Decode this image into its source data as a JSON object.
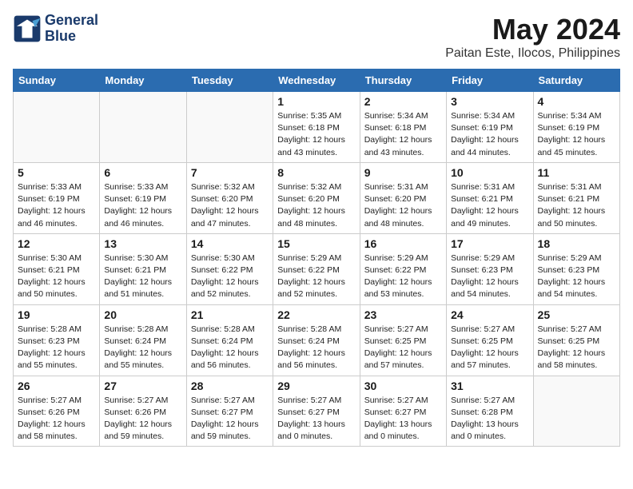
{
  "logo": {
    "line1": "General",
    "line2": "Blue"
  },
  "title": "May 2024",
  "location": "Paitan Este, Ilocos, Philippines",
  "weekdays": [
    "Sunday",
    "Monday",
    "Tuesday",
    "Wednesday",
    "Thursday",
    "Friday",
    "Saturday"
  ],
  "weeks": [
    [
      {
        "day": "",
        "info": ""
      },
      {
        "day": "",
        "info": ""
      },
      {
        "day": "",
        "info": ""
      },
      {
        "day": "1",
        "info": "Sunrise: 5:35 AM\nSunset: 6:18 PM\nDaylight: 12 hours\nand 43 minutes."
      },
      {
        "day": "2",
        "info": "Sunrise: 5:34 AM\nSunset: 6:18 PM\nDaylight: 12 hours\nand 43 minutes."
      },
      {
        "day": "3",
        "info": "Sunrise: 5:34 AM\nSunset: 6:19 PM\nDaylight: 12 hours\nand 44 minutes."
      },
      {
        "day": "4",
        "info": "Sunrise: 5:34 AM\nSunset: 6:19 PM\nDaylight: 12 hours\nand 45 minutes."
      }
    ],
    [
      {
        "day": "5",
        "info": "Sunrise: 5:33 AM\nSunset: 6:19 PM\nDaylight: 12 hours\nand 46 minutes."
      },
      {
        "day": "6",
        "info": "Sunrise: 5:33 AM\nSunset: 6:19 PM\nDaylight: 12 hours\nand 46 minutes."
      },
      {
        "day": "7",
        "info": "Sunrise: 5:32 AM\nSunset: 6:20 PM\nDaylight: 12 hours\nand 47 minutes."
      },
      {
        "day": "8",
        "info": "Sunrise: 5:32 AM\nSunset: 6:20 PM\nDaylight: 12 hours\nand 48 minutes."
      },
      {
        "day": "9",
        "info": "Sunrise: 5:31 AM\nSunset: 6:20 PM\nDaylight: 12 hours\nand 48 minutes."
      },
      {
        "day": "10",
        "info": "Sunrise: 5:31 AM\nSunset: 6:21 PM\nDaylight: 12 hours\nand 49 minutes."
      },
      {
        "day": "11",
        "info": "Sunrise: 5:31 AM\nSunset: 6:21 PM\nDaylight: 12 hours\nand 50 minutes."
      }
    ],
    [
      {
        "day": "12",
        "info": "Sunrise: 5:30 AM\nSunset: 6:21 PM\nDaylight: 12 hours\nand 50 minutes."
      },
      {
        "day": "13",
        "info": "Sunrise: 5:30 AM\nSunset: 6:21 PM\nDaylight: 12 hours\nand 51 minutes."
      },
      {
        "day": "14",
        "info": "Sunrise: 5:30 AM\nSunset: 6:22 PM\nDaylight: 12 hours\nand 52 minutes."
      },
      {
        "day": "15",
        "info": "Sunrise: 5:29 AM\nSunset: 6:22 PM\nDaylight: 12 hours\nand 52 minutes."
      },
      {
        "day": "16",
        "info": "Sunrise: 5:29 AM\nSunset: 6:22 PM\nDaylight: 12 hours\nand 53 minutes."
      },
      {
        "day": "17",
        "info": "Sunrise: 5:29 AM\nSunset: 6:23 PM\nDaylight: 12 hours\nand 54 minutes."
      },
      {
        "day": "18",
        "info": "Sunrise: 5:29 AM\nSunset: 6:23 PM\nDaylight: 12 hours\nand 54 minutes."
      }
    ],
    [
      {
        "day": "19",
        "info": "Sunrise: 5:28 AM\nSunset: 6:23 PM\nDaylight: 12 hours\nand 55 minutes."
      },
      {
        "day": "20",
        "info": "Sunrise: 5:28 AM\nSunset: 6:24 PM\nDaylight: 12 hours\nand 55 minutes."
      },
      {
        "day": "21",
        "info": "Sunrise: 5:28 AM\nSunset: 6:24 PM\nDaylight: 12 hours\nand 56 minutes."
      },
      {
        "day": "22",
        "info": "Sunrise: 5:28 AM\nSunset: 6:24 PM\nDaylight: 12 hours\nand 56 minutes."
      },
      {
        "day": "23",
        "info": "Sunrise: 5:27 AM\nSunset: 6:25 PM\nDaylight: 12 hours\nand 57 minutes."
      },
      {
        "day": "24",
        "info": "Sunrise: 5:27 AM\nSunset: 6:25 PM\nDaylight: 12 hours\nand 57 minutes."
      },
      {
        "day": "25",
        "info": "Sunrise: 5:27 AM\nSunset: 6:25 PM\nDaylight: 12 hours\nand 58 minutes."
      }
    ],
    [
      {
        "day": "26",
        "info": "Sunrise: 5:27 AM\nSunset: 6:26 PM\nDaylight: 12 hours\nand 58 minutes."
      },
      {
        "day": "27",
        "info": "Sunrise: 5:27 AM\nSunset: 6:26 PM\nDaylight: 12 hours\nand 59 minutes."
      },
      {
        "day": "28",
        "info": "Sunrise: 5:27 AM\nSunset: 6:27 PM\nDaylight: 12 hours\nand 59 minutes."
      },
      {
        "day": "29",
        "info": "Sunrise: 5:27 AM\nSunset: 6:27 PM\nDaylight: 13 hours\nand 0 minutes."
      },
      {
        "day": "30",
        "info": "Sunrise: 5:27 AM\nSunset: 6:27 PM\nDaylight: 13 hours\nand 0 minutes."
      },
      {
        "day": "31",
        "info": "Sunrise: 5:27 AM\nSunset: 6:28 PM\nDaylight: 13 hours\nand 0 minutes."
      },
      {
        "day": "",
        "info": ""
      }
    ]
  ]
}
